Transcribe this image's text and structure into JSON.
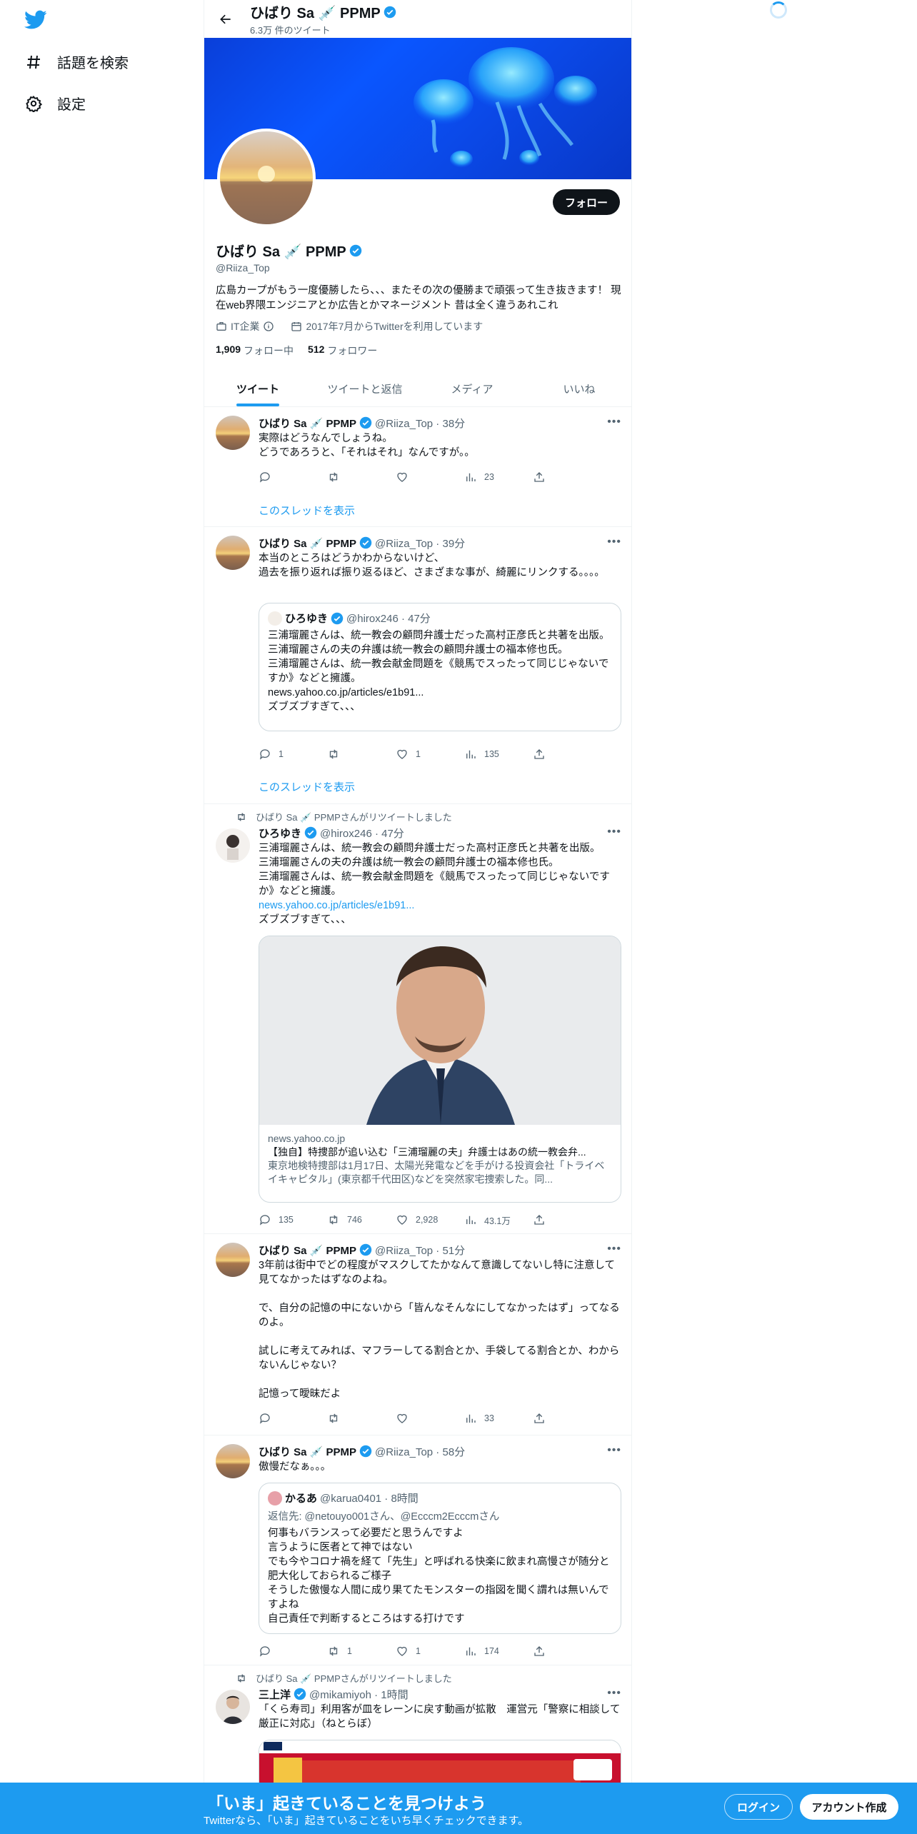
{
  "nav": {
    "explore_label": "話題を検索",
    "settings_label": "設定"
  },
  "header": {
    "name": "ひばり Sa 💉 PPMP",
    "tweet_count": "6.3万 件のツイート"
  },
  "profile": {
    "follow_label": "フォロー",
    "name": "ひばり Sa 💉 PPMP",
    "handle": "@Riiza_Top",
    "bio": "広島カープがもう一度優勝したら、、、またその次の優勝まで頑張って生き抜きます！ 現在web界隈エンジニアとか広告とかマネージメント 昔は全く違うあれこれ",
    "category": "IT企業",
    "joined": "2017年7月からTwitterを利用しています",
    "following_count": "1,909",
    "following_label": "フォロー中",
    "followers_count": "512",
    "followers_label": "フォロワー"
  },
  "tabs": [
    "ツイート",
    "ツイートと返信",
    "メディア",
    "いいね"
  ],
  "tweets": [
    {
      "name": "ひばり Sa 💉 PPMP",
      "meta": "@Riiza_Top · 38分",
      "text": "実際はどうなんでしょうね。\nどうであろうと、「それはそれ」なんですが。。",
      "reply": "",
      "retweet": "",
      "like": "",
      "views": "23",
      "thread": "このスレッドを表示"
    },
    {
      "name": "ひばり Sa 💉 PPMP",
      "meta": "@Riiza_Top · 39分",
      "text": "本当のところはどうかわからないけど、\n過去を振り返れば振り返るほど、さまざまな事が、綺麗にリンクする。。。。",
      "quote": {
        "name": "ひろゆき",
        "meta": "@hirox246 · 47分",
        "text": "三浦瑠麗さんは、統一教会の顧問弁護士だった高村正彦氏と共著を出版。\n三浦瑠麗さんの夫の弁護は統一教会の顧問弁護士の福本修也氏。\n三浦瑠麗さんは、統一教会献金問題を《競馬でスったって同じじゃないですか》などと擁護。\nnews.yahoo.co.jp/articles/e1b91...\nズブズブすぎて、、、"
      },
      "reply": "1",
      "retweet": "",
      "like": "1",
      "views": "135",
      "thread": "このスレッドを表示"
    },
    {
      "retweeted_by": "ひばり Sa 💉 PPMPさんがリツイートしました",
      "name": "ひろゆき",
      "meta": "@hirox246 · 47分",
      "text_before": "三浦瑠麗さんは、統一教会の顧問弁護士だった高村正彦氏と共著を出版。\n三浦瑠麗さんの夫の弁護は統一教会の顧問弁護士の福本修也氏。\n三浦瑠麗さんは、統一教会献金問題を《競馬でスったって同じじゃないですか》などと擁護。",
      "link": "news.yahoo.co.jp/articles/e1b91...",
      "text_after": "ズブズブすぎて、、、",
      "card": {
        "domain": "news.yahoo.co.jp",
        "title": "【独自】特捜部が追い込む「三浦瑠麗の夫」弁護士はあの統一教会弁...",
        "desc": "東京地検特捜部は1月17日、太陽光発電などを手がける投資会社「トライベイキャピタル」(東京都千代田区)などを突然家宅捜索した。同..."
      },
      "reply": "135",
      "retweet": "746",
      "like": "2,928",
      "views": "43.1万"
    },
    {
      "name": "ひばり Sa 💉 PPMP",
      "meta": "@Riiza_Top · 51分",
      "text": "3年前は街中でどの程度がマスクしてたかなんて意識してないし特に注意して見てなかったはずなのよね。\n\nで、自分の記憶の中にないから「皆んなそんなにしてなかったはず」ってなるのよ。\n\n試しに考えてみれば、マフラーしてる割合とか、手袋してる割合とか、わからないんじゃない？\n\n記憶って曖昧だよ",
      "reply": "",
      "retweet": "",
      "like": "",
      "views": "33"
    },
    {
      "name": "ひばり Sa 💉 PPMP",
      "meta": "@Riiza_Top · 58分",
      "text": "傲慢だなぁ。。。",
      "quote": {
        "name": "かるあ",
        "meta": "@karua0401 · 8時間",
        "reply_to": "返信先: @netouyo001さん、@Ecccm2Ecccmさん",
        "text": "何事もバランスって必要だと思うんですよ\n言うように医者とて神ではない\nでも今やコロナ禍を経て「先生」と呼ばれる快楽に飲まれ高慢さが随分と肥大化しておられるご様子\nそうした傲慢な人間に成り果てたモンスターの指図を聞く謂れは無いんですよね\n自己責任で判断するところはする打けです"
      },
      "reply": "",
      "retweet": "1",
      "like": "1",
      "views": "174"
    },
    {
      "retweeted_by": "ひばり Sa 💉 PPMPさんがリツイートしました",
      "name": "三上洋",
      "meta": "@mikamiyoh · 1時間",
      "text": "「くら寿司」利用客が皿をレーンに戻す動画が拡散　運営元「警察に相談して厳正に対応」（ねとらぼ）"
    }
  ],
  "bottom": {
    "title": "「いま」起きていることを見つけよう",
    "subtitle": "Twitterなら、「いま」起きていることをいち早くチェックできます。",
    "login": "ログイン",
    "signup": "アカウント作成"
  }
}
